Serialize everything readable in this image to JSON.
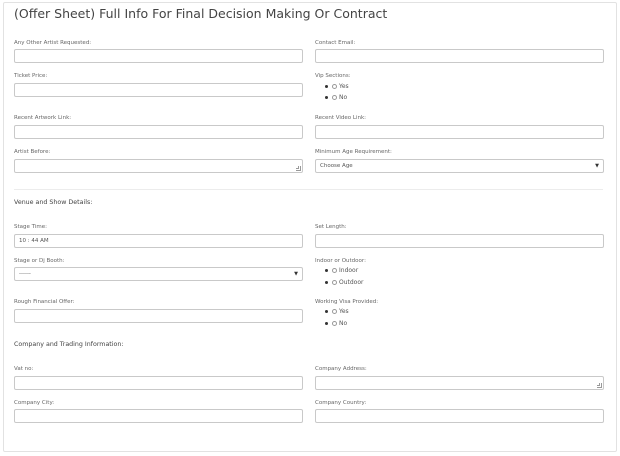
{
  "form": {
    "title": "(Offer Sheet) Full Info For Final Decision Making Or Contract",
    "fields": {
      "other_artist": {
        "label": "Any Other Artist Requested:",
        "value": ""
      },
      "contact_email": {
        "label": "Contact Email:",
        "value": ""
      },
      "ticket_price": {
        "label": "Ticket Price:",
        "value": ""
      },
      "vip_sections": {
        "label": "Vip Sections:",
        "options": [
          "Yes",
          "No"
        ]
      },
      "recent_artwork": {
        "label": "Recent Artwork Link:",
        "value": ""
      },
      "recent_video": {
        "label": "Recent Video Link:",
        "value": ""
      },
      "artist_before": {
        "label": "Artist Before:",
        "value": ""
      },
      "min_age": {
        "label": "Minimum Age Requirement:",
        "selected": "Choose Age"
      },
      "stage_time": {
        "label": "Stage Time:",
        "value": "10 : 44 AM"
      },
      "set_length": {
        "label": "Set Length:",
        "value": ""
      },
      "stage_booth": {
        "label": "Stage or Dj Booth:",
        "selected": "------"
      },
      "indoor_outdoor": {
        "label": "Indoor or Outdoor:",
        "options": [
          "Indoor",
          "Outdoor"
        ]
      },
      "financial_offer": {
        "label": "Rough Financial Offer:",
        "value": ""
      },
      "working_visa": {
        "label": "Working Visa Provided:",
        "options": [
          "Yes",
          "No"
        ]
      },
      "vat_no": {
        "label": "Vat no:",
        "value": ""
      },
      "company_address": {
        "label": "Company Address:",
        "value": ""
      },
      "company_city": {
        "label": "Company City:",
        "value": ""
      },
      "company_country": {
        "label": "Company Country:",
        "value": ""
      }
    },
    "sections": {
      "venue": "Venue and Show Details:",
      "company": "Company and Trading Information:"
    }
  }
}
